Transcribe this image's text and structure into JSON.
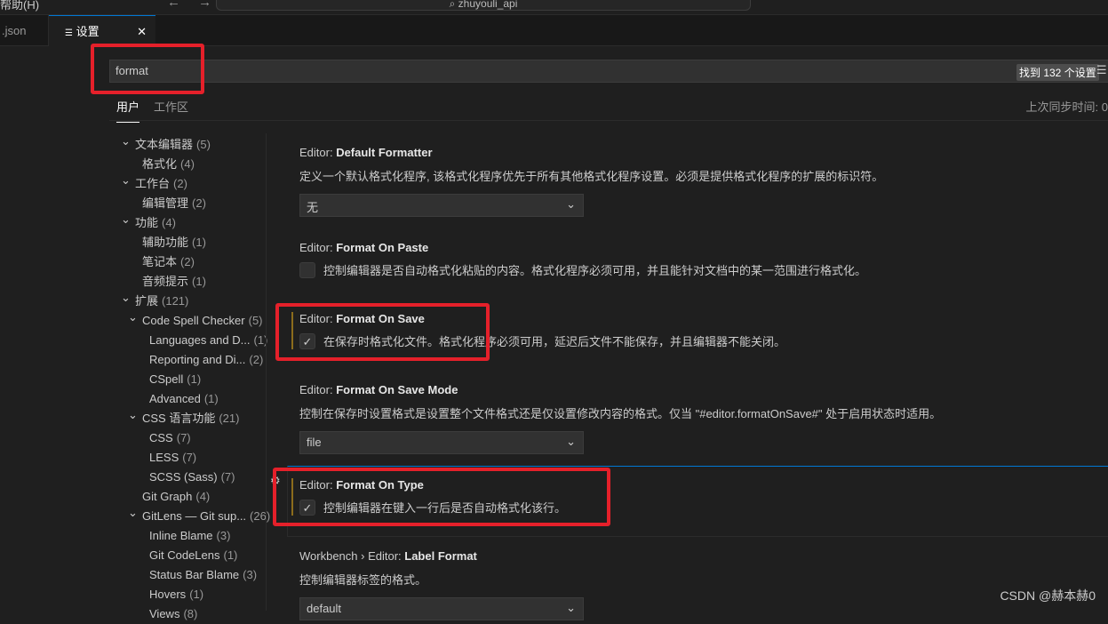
{
  "titlebar": {
    "menu": "帮助(H)",
    "command_center": "zhuyouli_api",
    "nav": "← →"
  },
  "tabs": [
    {
      "label": ".json"
    },
    {
      "label": "设置",
      "icon": "settings-lines-icon",
      "close": "✕"
    }
  ],
  "search": {
    "value": "format",
    "result": "找到 132 个设置",
    "filter_icon": "☰"
  },
  "scope_tabs": [
    {
      "label": "用户"
    },
    {
      "label": "工作区"
    }
  ],
  "sync": "上次同步时间: 0",
  "tree": [
    {
      "label": "文本编辑器",
      "count": "(5)",
      "level": 0,
      "chev": "⌄"
    },
    {
      "label": "格式化",
      "count": "(4)",
      "level": 1
    },
    {
      "label": "工作台",
      "count": "(2)",
      "level": 0,
      "chev": "⌄"
    },
    {
      "label": "编辑管理",
      "count": "(2)",
      "level": 1
    },
    {
      "label": "功能",
      "count": "(4)",
      "level": 0,
      "chev": "⌄"
    },
    {
      "label": "辅助功能",
      "count": "(1)",
      "level": 1
    },
    {
      "label": "笔记本",
      "count": "(2)",
      "level": 1
    },
    {
      "label": "音频提示",
      "count": "(1)",
      "level": 1
    },
    {
      "label": "扩展",
      "count": "(121)",
      "level": 0,
      "chev": "⌄"
    },
    {
      "label": "Code Spell Checker",
      "count": "(5)",
      "level": 1,
      "chev": "⌄"
    },
    {
      "label": "Languages and D...",
      "count": "(1)",
      "level": 2
    },
    {
      "label": "Reporting and Di...",
      "count": "(2)",
      "level": 2
    },
    {
      "label": "CSpell",
      "count": "(1)",
      "level": 2
    },
    {
      "label": "Advanced",
      "count": "(1)",
      "level": 2
    },
    {
      "label": "CSS 语言功能",
      "count": "(21)",
      "level": 1,
      "chev": "⌄"
    },
    {
      "label": "CSS",
      "count": "(7)",
      "level": 2
    },
    {
      "label": "LESS",
      "count": "(7)",
      "level": 2
    },
    {
      "label": "SCSS (Sass)",
      "count": "(7)",
      "level": 2
    },
    {
      "label": "Git Graph",
      "count": "(4)",
      "level": 1
    },
    {
      "label": "GitLens — Git sup...",
      "count": "(26)",
      "level": 1,
      "chev": "⌄"
    },
    {
      "label": "Inline Blame",
      "count": "(3)",
      "level": 2
    },
    {
      "label": "Git CodeLens",
      "count": "(1)",
      "level": 2
    },
    {
      "label": "Status Bar Blame",
      "count": "(3)",
      "level": 2
    },
    {
      "label": "Hovers",
      "count": "(1)",
      "level": 2
    },
    {
      "label": "Views",
      "count": "(8)",
      "level": 2
    }
  ],
  "settings": {
    "default_formatter": {
      "prefix": "Editor: ",
      "name": "Default Formatter",
      "desc": "定义一个默认格式化程序, 该格式化程序优先于所有其他格式化程序设置。必须是提供格式化程序的扩展的标识符。",
      "value": "无"
    },
    "format_on_paste": {
      "prefix": "Editor: ",
      "name": "Format On Paste",
      "desc": "控制编辑器是否自动格式化粘贴的内容。格式化程序必须可用，并且能针对文档中的某一范围进行格式化。",
      "checked": false
    },
    "format_on_save": {
      "prefix": "Editor: ",
      "name": "Format On Save",
      "desc": "在保存时格式化文件。格式化程序必须可用，延迟后文件不能保存，并且编辑器不能关闭。",
      "checked": true
    },
    "format_on_save_mode": {
      "prefix": "Editor: ",
      "name": "Format On Save Mode",
      "desc": "控制在保存时设置格式是设置整个文件格式还是仅设置修改内容的格式。仅当 \"#editor.formatOnSave#\" 处于启用状态时适用。",
      "value": "file"
    },
    "format_on_type": {
      "prefix": "Editor: ",
      "name": "Format On Type",
      "desc": "控制编辑器在键入一行后是否自动格式化该行。",
      "checked": true
    },
    "label_format": {
      "prefix": "Workbench › Editor: ",
      "name": "Label Format",
      "desc": "控制编辑器标签的格式。",
      "value": "default"
    }
  },
  "check_glyph": "✓",
  "chevron_glyph": "⌄",
  "gear_glyph": "⚙",
  "watermark": "CSDN @赫本赫0",
  "colors": {
    "accent": "#0078d4",
    "highlight_box": "#e5202a",
    "modified": "#8c6c1c"
  }
}
